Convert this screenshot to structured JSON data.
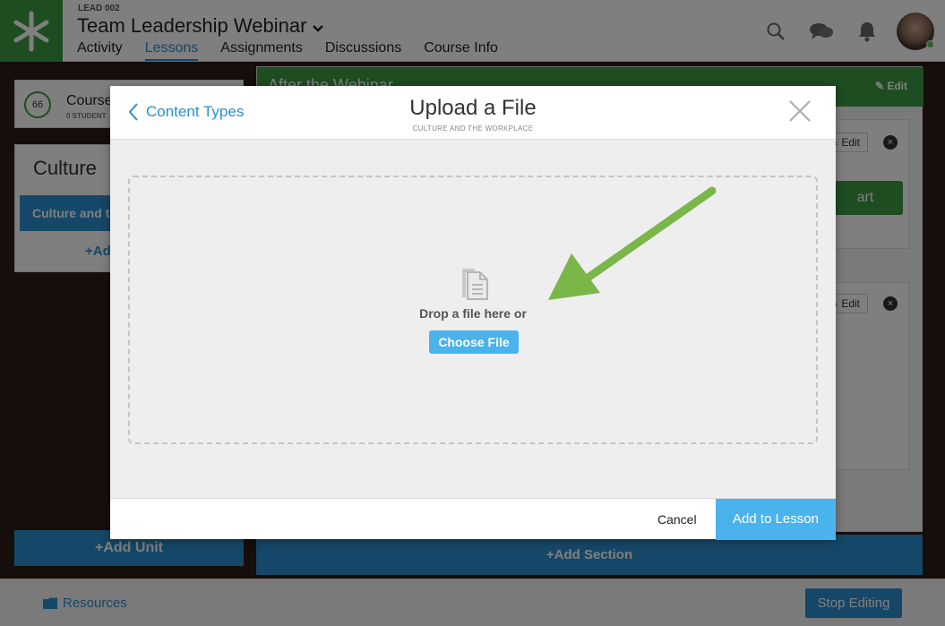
{
  "header": {
    "course_code": "LEAD 002",
    "course_title": "Team Leadership Webinar",
    "tabs": [
      {
        "label": "Activity"
      },
      {
        "label": "Lessons"
      },
      {
        "label": "Assignments"
      },
      {
        "label": "Discussions"
      },
      {
        "label": "Course Info"
      }
    ],
    "active_tab": "Lessons",
    "icons": [
      "search-icon",
      "chat-icon",
      "bell-icon"
    ]
  },
  "sidebar": {
    "progress": "66",
    "course_label": "Course",
    "students_label": "0 STUDENT",
    "unit_title": "Culture",
    "unit_item": "Culture and t",
    "unit_add": "+Add",
    "add_unit": "+Add Unit"
  },
  "main": {
    "section_title": "After the Webinar",
    "edit_label": "Edit",
    "start_label": "art",
    "add_section": "+Add Section"
  },
  "footer": {
    "resources": "Resources",
    "stop_editing": "Stop Editing"
  },
  "modal": {
    "back_label": "Content Types",
    "title": "Upload a File",
    "subtitle": "CULTURE AND THE WORKPLACE",
    "drop_text": "Drop a file here or",
    "choose_file": "Choose File",
    "cancel": "Cancel",
    "add_to_lesson": "Add to Lesson"
  },
  "colors": {
    "brand_green": "#3b9b43",
    "link_blue": "#2b8fd0",
    "button_blue": "#4ab3ec",
    "arrow_green": "#7ab648"
  }
}
